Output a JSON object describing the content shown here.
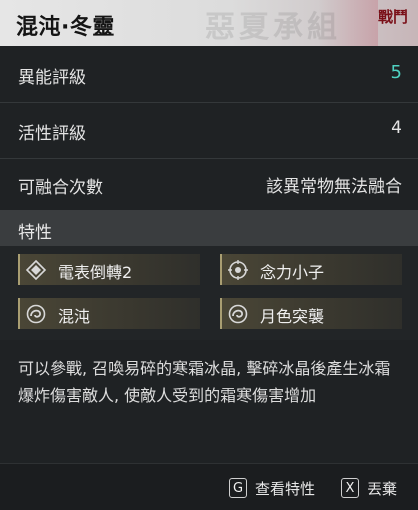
{
  "header": {
    "title": "混沌·冬靈",
    "tag": "戰鬥",
    "watermark": "惡夏承組"
  },
  "stats": [
    {
      "label": "異能評級",
      "value": "5"
    },
    {
      "label": "活性評級",
      "value": "4"
    },
    {
      "label": "可融合次數",
      "value": "該異常物無法融合"
    }
  ],
  "traits_section": {
    "label": "特性",
    "items": [
      {
        "name": "電表倒轉2",
        "icon": "diamond-icon"
      },
      {
        "name": "念力小子",
        "icon": "target-icon"
      },
      {
        "name": "混沌",
        "icon": "swirl-icon"
      },
      {
        "name": "月色突襲",
        "icon": "swirl-icon"
      }
    ]
  },
  "description": "可以參戰, 召喚易碎的寒霜冰晶, 擊碎冰晶後產生冰霜爆炸傷害敵人, 使敵人受到的霜寒傷害增加",
  "footer": {
    "view": {
      "key": "G",
      "label": "查看特性"
    },
    "discard": {
      "key": "X",
      "label": "丟棄"
    }
  },
  "colors": {
    "accent": "#4fd2c2",
    "tag": "#7a0f18",
    "trait_border": "#a99e72"
  }
}
